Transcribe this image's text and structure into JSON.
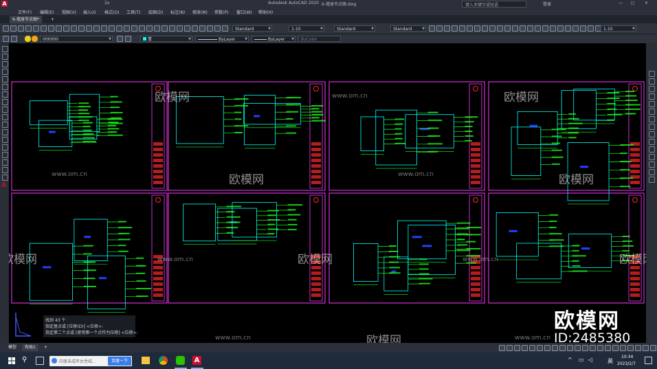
{
  "app": {
    "title": "Autodesk AutoCAD 2020",
    "file_name": "6-墙身节点图.dwg",
    "search_placeholder": "键入关键字或短语",
    "login": "登录",
    "quick_access_label": "2x"
  },
  "menu": {
    "items": [
      "文件(F)",
      "编辑(E)",
      "视图(V)",
      "插入(I)",
      "格式(O)",
      "工具(T)",
      "绘图(D)",
      "标注(N)",
      "修改(M)",
      "参数(P)",
      "窗口(W)",
      "帮助(H)"
    ]
  },
  "tabs": {
    "drawing": "6-墙身节点图*",
    "add": "+"
  },
  "toolbar": {
    "text_style": "Standard",
    "dim_scale": "1-10",
    "dim_style": "Standard",
    "table_style": "Standard",
    "annot_scale": "1-10"
  },
  "properties": {
    "layer": "000000",
    "color": "青",
    "linetype": "ByLayer",
    "lineweight": "ByLayer",
    "plotstyle": "ByColor"
  },
  "command": {
    "line1": "找到 43 个",
    "line2": "指定基点或 [位移(D)] <位移>:",
    "line3": "指定第二个点或 [使用第一个点作为位移] <位移>:"
  },
  "watermarks": {
    "brand": "欧模网",
    "url": "www.om.cn",
    "big": "欧模网",
    "id": "ID:2485380"
  },
  "status": {
    "model_tab": "模型",
    "layout_tab": "布局1",
    "add": "+"
  },
  "taskbar": {
    "search_placeholder": "印度未成年女性结...",
    "search_button": "百度一下",
    "ime": "英",
    "time": "10:34",
    "date": "2023/2/7"
  },
  "colors": {
    "accent_green": "#19ff19",
    "cyan": "#00ffff",
    "magenta": "#ff3bff",
    "red": "#ff2a2a",
    "blue": "#2340ff"
  }
}
